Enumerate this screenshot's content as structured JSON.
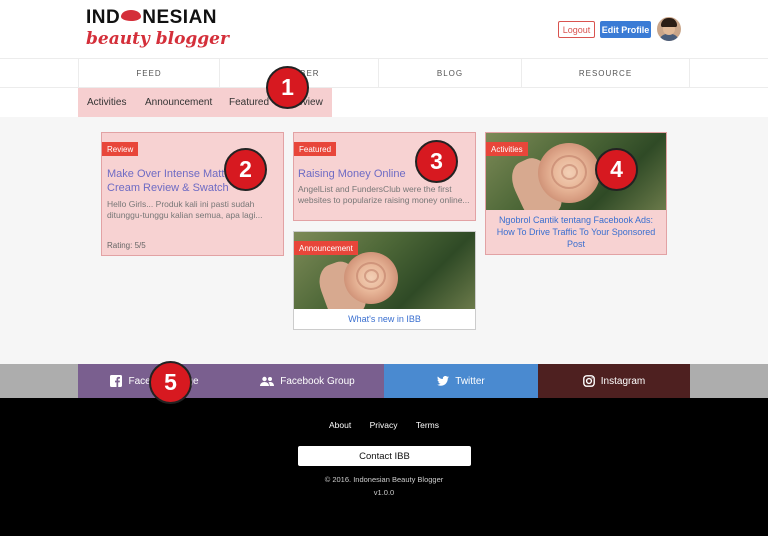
{
  "header": {
    "logo_line1": "INDONESIAN",
    "logo_line2": "beauty blogger",
    "logout_label": "Logout",
    "edit_profile_label": "Edit Profile"
  },
  "main_nav": {
    "tabs": [
      {
        "label": "FEED"
      },
      {
        "label": "MEMBER"
      },
      {
        "label": "BLOG"
      },
      {
        "label": "RESOURCE"
      }
    ]
  },
  "sub_nav": {
    "items": [
      {
        "label": "Activities"
      },
      {
        "label": "Announcement"
      },
      {
        "label": "Featured"
      },
      {
        "label": "Review"
      }
    ]
  },
  "cards": {
    "review": {
      "badge": "Review",
      "title": "Make Over Intense Matte Lip Cream Review & Swatch",
      "excerpt": "Hello Girls... Produk kali ini pasti sudah ditunggu-tunggu kalian semua, apa lagi...",
      "rating": "Rating: 5/5"
    },
    "featured": {
      "badge": "Featured",
      "title": "Raising Money Online",
      "excerpt": "AngelList and FundersClub were the first websites to popularize raising money online..."
    },
    "announcement": {
      "badge": "Announcement",
      "link": "What's new in IBB"
    },
    "activities": {
      "badge": "Activities",
      "link": "Ngobrol Cantik tentang Facebook Ads: How To Drive Traffic To Your Sponsored Post"
    }
  },
  "social": {
    "items": [
      {
        "label": "Facebook Page",
        "icon": "facebook-icon",
        "color": "#7a5f8f"
      },
      {
        "label": "Facebook Group",
        "icon": "people-icon",
        "color": "#7a5f8f"
      },
      {
        "label": "Twitter",
        "icon": "twitter-icon",
        "color": "#4a8ad0"
      },
      {
        "label": "Instagram",
        "icon": "instagram-icon",
        "color": "#4e2020"
      }
    ]
  },
  "footer": {
    "links": [
      {
        "label": "About"
      },
      {
        "label": "Privacy"
      },
      {
        "label": "Terms"
      }
    ],
    "contact_label": "Contact IBB",
    "copyright": "© 2016. Indonesian Beauty Blogger",
    "version": "v1.0.0"
  },
  "markers": [
    "1",
    "2",
    "3",
    "4",
    "5"
  ],
  "colors": {
    "brand_red": "#d42f3a",
    "badge_red": "#e8463a",
    "card_pink": "#f7d2d2",
    "link_blue": "#3a6fd0",
    "title_purple": "#6e6bc4"
  }
}
